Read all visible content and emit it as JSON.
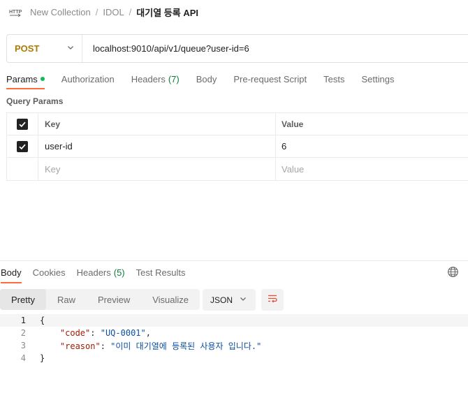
{
  "breadcrumb": {
    "icon": "http-icon",
    "collection": "New Collection",
    "folder": "IDOL",
    "request": "대기열 등록 API",
    "separator": "/"
  },
  "request": {
    "method": "POST",
    "url": "localhost:9010/api/v1/queue?user-id=6"
  },
  "request_tabs": {
    "params": "Params",
    "authorization": "Authorization",
    "headers": "Headers",
    "headers_count": "(7)",
    "body": "Body",
    "prerequest": "Pre-request Script",
    "tests": "Tests",
    "settings": "Settings"
  },
  "query_params": {
    "title": "Query Params",
    "columns": {
      "key": "Key",
      "value": "Value"
    },
    "rows": [
      {
        "checked": true,
        "key": "user-id",
        "value": "6"
      }
    ],
    "placeholder": {
      "key": "Key",
      "value": "Value"
    }
  },
  "response_tabs": {
    "body": "Body",
    "cookies": "Cookies",
    "headers": "Headers",
    "headers_count": "(5)",
    "test_results": "Test Results"
  },
  "view_modes": {
    "pretty": "Pretty",
    "raw": "Raw",
    "preview": "Preview",
    "visualize": "Visualize"
  },
  "format": {
    "selected": "JSON"
  },
  "code": {
    "line_numbers": [
      "1",
      "2",
      "3",
      "4"
    ],
    "open_brace": "{",
    "close_brace": "}",
    "code_key": "\"code\"",
    "code_value": "\"UQ-0001\"",
    "reason_key": "\"reason\"",
    "reason_value": "\"이미 대기열에 등록된 사용자 입니다.\""
  },
  "colors": {
    "accent": "#ff6c37",
    "method": "#ad7a03",
    "json_key": "#a11b06",
    "json_string": "#0b4ea2",
    "params_dot": "#0cbb52"
  }
}
